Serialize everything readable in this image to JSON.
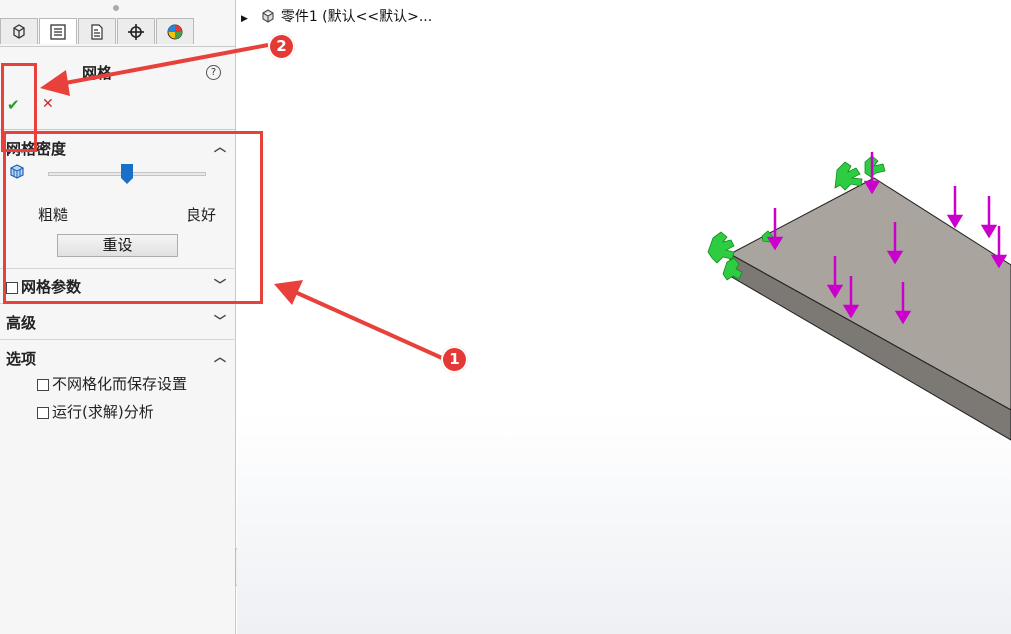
{
  "panel": {
    "tabs": [
      {
        "icon": "feature-manager-icon",
        "active": false
      },
      {
        "icon": "property-manager-icon",
        "active": true
      },
      {
        "icon": "configuration-manager-icon",
        "active": false
      },
      {
        "icon": "dimxpert-manager-icon",
        "active": false
      },
      {
        "icon": "display-manager-icon",
        "active": false
      }
    ],
    "title": "网格",
    "help_glyph": "?",
    "ok_glyph": "✔",
    "cancel_glyph": "✕",
    "density": {
      "heading": "网格密度",
      "slider_value": 0.5,
      "label_coarse": "粗糙",
      "label_fine": "良好",
      "reset_label": "重设"
    },
    "mesh_params": {
      "label": "网格参数",
      "checked": false
    },
    "advanced": {
      "heading": "高级"
    },
    "options": {
      "heading": "选项",
      "items": [
        {
          "label": "不网格化而保存设置",
          "checked": false
        },
        {
          "label": "运行(求解)分析",
          "checked": false
        }
      ]
    }
  },
  "tree": {
    "label": "零件1  (默认<<默认>..."
  },
  "annotations": {
    "badge_1": "1",
    "badge_2": "2",
    "color": "#e8403a"
  },
  "colors": {
    "accent_slider": "#1a6fc9",
    "load_arrow": "#cc00cc",
    "fixture": "#2ecc40",
    "plate_top": "#aaa49f"
  }
}
